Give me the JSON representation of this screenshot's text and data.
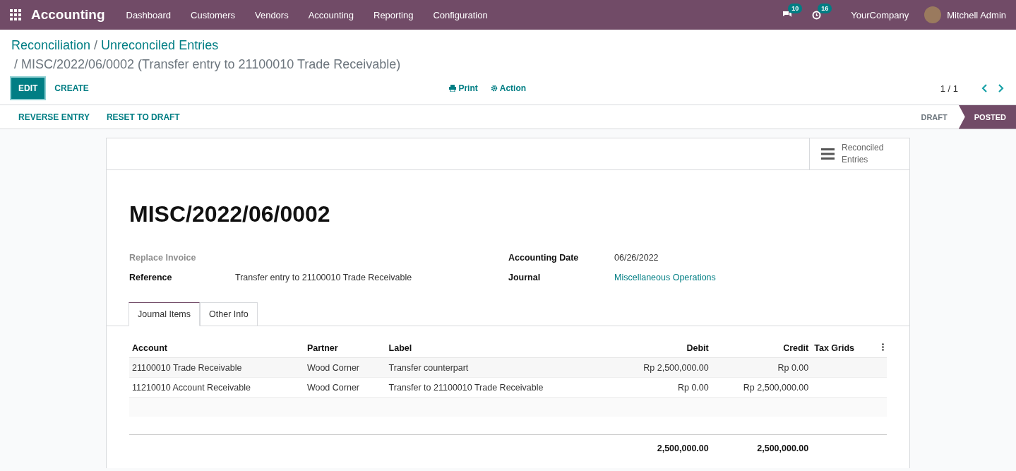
{
  "navbar": {
    "app_name": "Accounting",
    "menu": [
      "Dashboard",
      "Customers",
      "Vendors",
      "Accounting",
      "Reporting",
      "Configuration"
    ],
    "messages_count": "10",
    "activities_count": "16",
    "company": "YourCompany",
    "user": "Mitchell Admin"
  },
  "breadcrumbs": {
    "items": [
      "Reconciliation",
      "Unreconciled Entries"
    ],
    "separator": "/",
    "current": "/ MISC/2022/06/0002 (Transfer entry to 21100010 Trade Receivable)"
  },
  "buttons": [
    {
      "label": "EDIT",
      "kind": "primary"
    },
    {
      "label": "CREATE",
      "kind": "secondary"
    }
  ],
  "actions": [
    {
      "label": "Print",
      "kind": "print"
    },
    {
      "label": "Action",
      "kind": "gear"
    }
  ],
  "pager": "1 / 1",
  "header_buttons": [
    "REVERSE ENTRY",
    "RESET TO DRAFT"
  ],
  "stages": [
    {
      "label": "DRAFT",
      "selected": false
    },
    {
      "label": "POSTED",
      "selected": true
    }
  ],
  "smart_button": "Reconciled Entries",
  "title": "MISC/2022/06/0002",
  "left_fields": [
    {
      "label": "Replace Invoice",
      "kind": "muted"
    },
    {
      "label": "Reference",
      "value": "Transfer entry to 21100010 Trade Receivable",
      "kind": "text"
    }
  ],
  "right_fields": [
    {
      "label": "Accounting Date",
      "value": "06/26/2022",
      "kind": "text"
    },
    {
      "label": "Journal",
      "value": "Miscellaneous Operations",
      "kind": "link"
    }
  ],
  "tabs": [
    {
      "label": "Journal Items",
      "selected": true
    },
    {
      "label": "Other Info",
      "selected": false
    }
  ],
  "table": {
    "columns": [
      "Account",
      "Partner",
      "Label",
      "Debit",
      "Credit",
      "Tax Grids"
    ],
    "rows": [
      {
        "account": "21100010 Trade Receivable",
        "partner": "Wood Corner",
        "label": "Transfer counterpart",
        "debit": "Rp 2,500,000.00",
        "credit": "Rp 0.00"
      },
      {
        "account": "11210010 Account Receivable",
        "partner": "Wood Corner",
        "label": "Transfer to 21100010 Trade Receivable",
        "debit": "Rp 0.00",
        "credit": "Rp 2,500,000.00"
      }
    ],
    "totals": {
      "debit": "2,500,000.00",
      "credit": "2,500,000.00"
    }
  }
}
